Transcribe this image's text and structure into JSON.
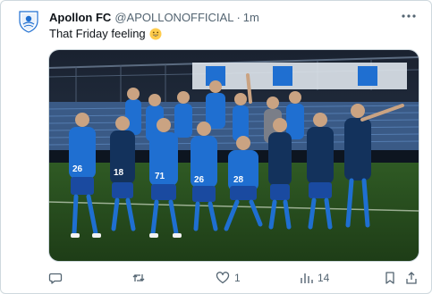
{
  "tweet": {
    "author_name": "Apollon FC",
    "author_handle": "@APOLLONOFFICIAL",
    "separator": "·",
    "time": "1m",
    "text": "That Friday feeling",
    "emoji": "grinning-face-emoji",
    "more_icon": "more-horizontal-icon"
  },
  "actions": {
    "reply_count": "",
    "retweet_count": "",
    "like_count": "1",
    "views_count": "14"
  },
  "colors": {
    "text_primary": "#0f1419",
    "text_secondary": "#536471",
    "border": "#cfd9de",
    "brand_blue": "#1f6fd1"
  }
}
